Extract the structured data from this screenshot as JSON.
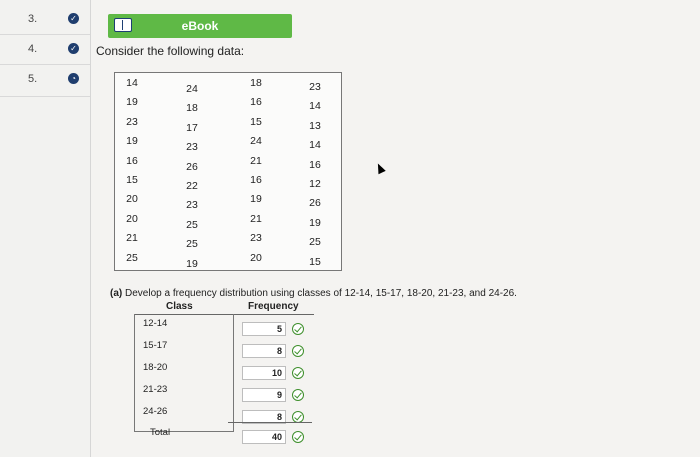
{
  "sidebar": {
    "questions": [
      {
        "number": "3.",
        "status": "complete"
      },
      {
        "number": "4.",
        "status": "complete"
      },
      {
        "number": "5.",
        "status": "current"
      }
    ]
  },
  "ebook": {
    "label": "eBook",
    "icon": "book-icon"
  },
  "prompt": "Consider the following data:",
  "data_columns": [
    [
      "14",
      "19",
      "23",
      "19",
      "16",
      "15",
      "20",
      "20",
      "21",
      "25"
    ],
    [
      "24",
      "18",
      "17",
      "23",
      "26",
      "22",
      "23",
      "25",
      "25",
      "19"
    ],
    [
      "18",
      "16",
      "15",
      "24",
      "21",
      "16",
      "19",
      "21",
      "23",
      "20"
    ],
    [
      "23",
      "14",
      "13",
      "14",
      "16",
      "12",
      "26",
      "19",
      "25",
      "15"
    ]
  ],
  "part_a": {
    "label": "(a)",
    "text": "Develop a frequency distribution using classes of 12-14, 15-17, 18-20, 21-23, and 24-26."
  },
  "freq_table": {
    "header_class": "Class",
    "header_frequency": "Frequency",
    "rows": [
      {
        "class": "12-14",
        "frequency": "5"
      },
      {
        "class": "15-17",
        "frequency": "8"
      },
      {
        "class": "18-20",
        "frequency": "10"
      },
      {
        "class": "21-23",
        "frequency": "9"
      },
      {
        "class": "24-26",
        "frequency": "8"
      }
    ],
    "total_label": "Total",
    "total_value": "40"
  },
  "colors": {
    "ebook_green": "#5fb946",
    "check_green": "#3e8f2c",
    "status_navy": "#1f3e6e"
  }
}
